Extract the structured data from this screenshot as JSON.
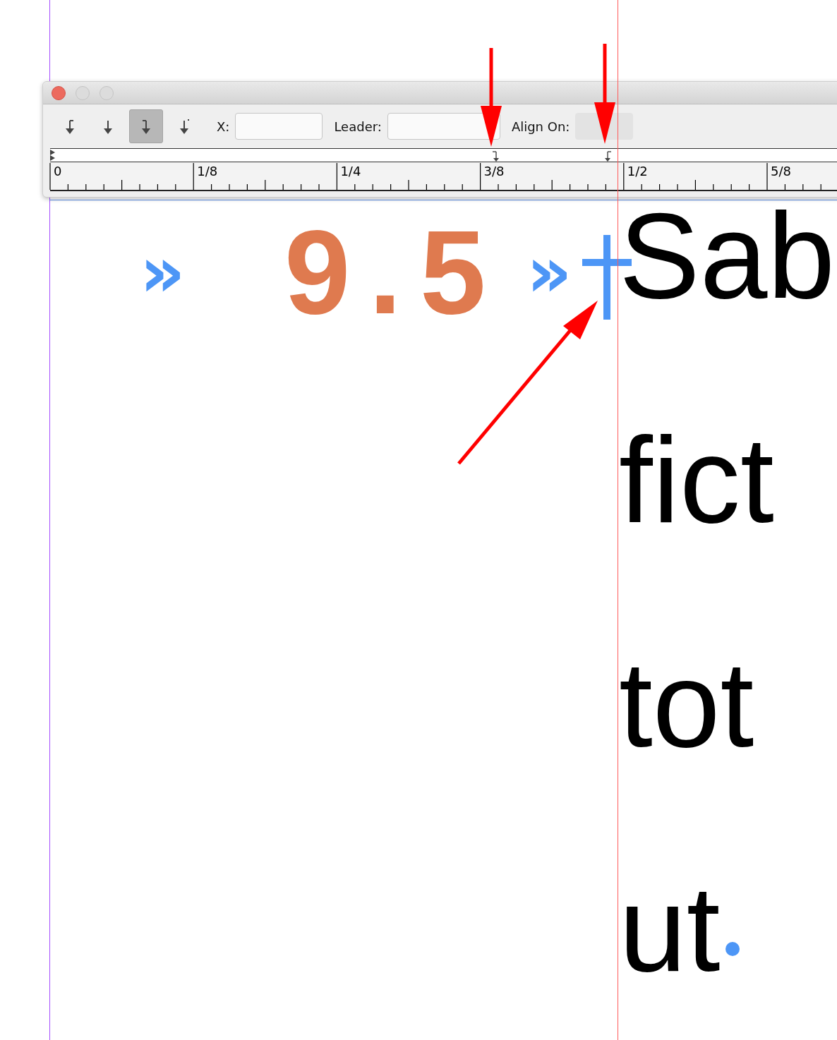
{
  "panel": {
    "window_controls": [
      {
        "kind": "close"
      },
      {
        "kind": "minimize"
      },
      {
        "kind": "zoom"
      }
    ],
    "tab_types": [
      {
        "kind": "left",
        "selected": false
      },
      {
        "kind": "center",
        "selected": false
      },
      {
        "kind": "right",
        "selected": true
      },
      {
        "kind": "decimal",
        "selected": false
      }
    ],
    "x_label": "X:",
    "leader_label": "Leader:",
    "align_on_label": "Align On:",
    "ruler_labels": [
      "0",
      "1/8",
      "1/4",
      "3/8",
      "1/2",
      "5/8"
    ],
    "tab_stops": [
      {
        "kind": "right"
      },
      {
        "kind": "left"
      }
    ]
  },
  "document": {
    "tab_marks": [
      "»",
      "»"
    ],
    "number": "9.5",
    "lines": [
      "Sab",
      "fict",
      "tot",
      "ut"
    ]
  }
}
